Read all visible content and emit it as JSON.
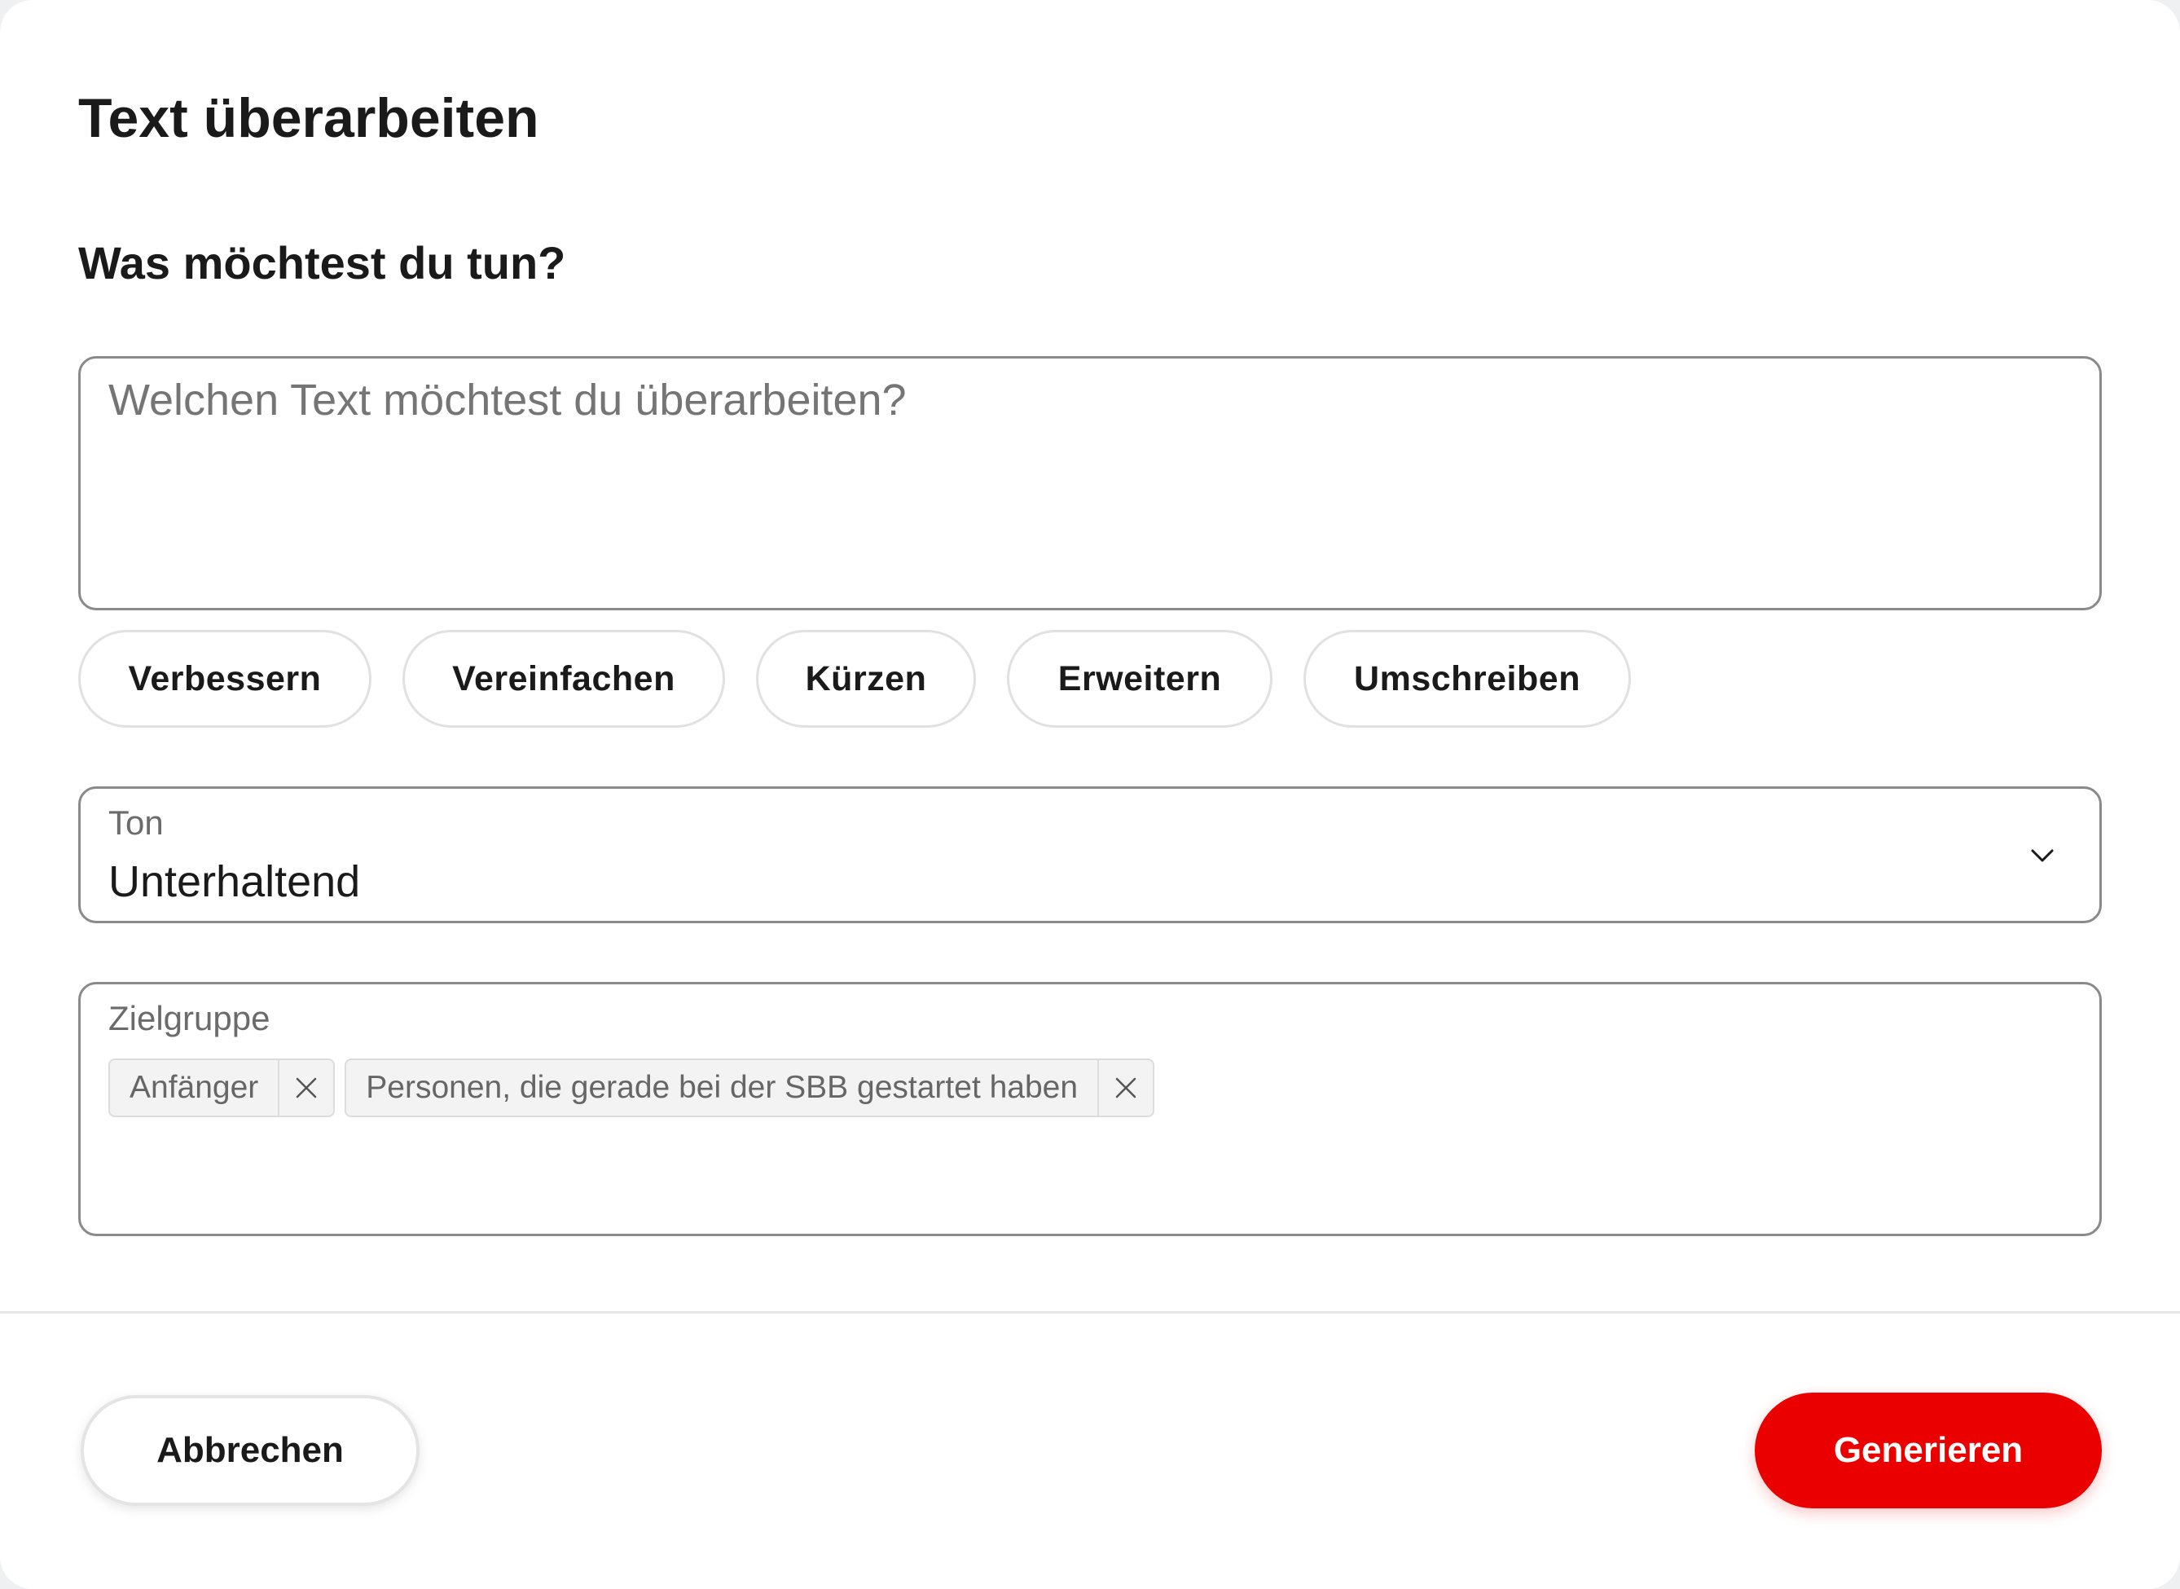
{
  "dialog": {
    "title": "Text überarbeiten",
    "section_title": "Was möchtest du tun?"
  },
  "text_input": {
    "value": "",
    "placeholder": "Welchen Text möchtest du überarbeiten?"
  },
  "actions": [
    {
      "label": "Verbessern"
    },
    {
      "label": "Vereinfachen"
    },
    {
      "label": "Kürzen"
    },
    {
      "label": "Erweitern"
    },
    {
      "label": "Umschreiben"
    }
  ],
  "tone": {
    "label": "Ton",
    "value": "Unterhaltend",
    "icon": "chevron-down-icon"
  },
  "audience": {
    "label": "Zielgruppe",
    "tags": [
      {
        "text": "Anfänger",
        "icon": "close-icon"
      },
      {
        "text": "Personen, die gerade bei der SBB gestartet haben",
        "icon": "close-icon"
      }
    ]
  },
  "footer": {
    "cancel_label": "Abbrechen",
    "generate_label": "Generieren"
  },
  "colors": {
    "primary": "#eb0000",
    "border": "#8a8a8a",
    "chip_border": "#e1e1e1",
    "text": "#1a1a1a",
    "muted": "#6b6b6b"
  }
}
